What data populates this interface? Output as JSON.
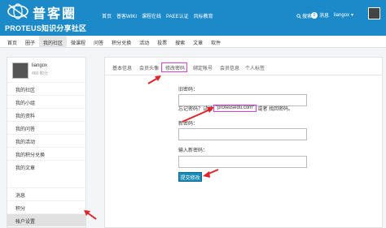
{
  "header": {
    "logo_title": "普客圈",
    "logo_subtitle": "PROTEUS知识分享社区",
    "nav": [
      "首页",
      "普客WIKI",
      "课程在线",
      "PAEE认证",
      "风标教育"
    ],
    "search_label": "搜索",
    "message_count": "0",
    "message_label": "消息",
    "username": "liangox"
  },
  "subnav": {
    "items": [
      "首页",
      "圈子",
      "我的社区",
      "微课程",
      "问答",
      "积分兑换",
      "活动",
      "投票",
      "搜索",
      "文章",
      "软件"
    ],
    "active_index": 2
  },
  "sidebar": {
    "username": "liangox",
    "points": "460 积分",
    "items": [
      "我的社区",
      "我的小组",
      "我的资料",
      "我的问答",
      "我的活动",
      "我的积分兑换",
      "我的文章",
      "消息",
      "积分",
      "帐户设置"
    ],
    "active_index": 9
  },
  "settings": {
    "tabs": [
      "基本信息",
      "会员头像",
      "修改密码",
      "绑定帐号",
      "会员信息",
      "个人标签"
    ],
    "active_tab": 2,
    "old_password_label": "旧密码：",
    "forgot_prefix": "忘记密码？试试",
    "forgot_link": "\"proteusedu.com\"",
    "forgot_suffix": "或者 找回密码。",
    "new_password_label": "新密码：",
    "confirm_password_label": "输入新密码：",
    "submit_label": "提交修改"
  },
  "colors": {
    "header_bg": "#1c8ac9",
    "highlight": "#e53be5",
    "arrow": "#e0242b",
    "button": "#1a8bb7"
  }
}
